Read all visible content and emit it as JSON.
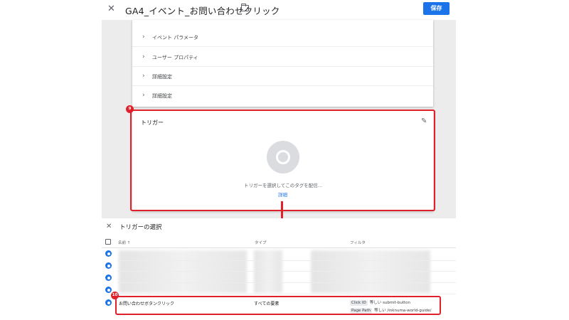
{
  "header": {
    "title": "GA4_イベント_お問い合わせクリック",
    "save_label": "保存"
  },
  "tag_config": {
    "rows": [
      {
        "label": "イベント パラメータ"
      },
      {
        "label": "ユーザー プロパティ"
      },
      {
        "label": "詳細設定"
      },
      {
        "label": "詳細設定"
      }
    ]
  },
  "trigger_section": {
    "badge": "9",
    "title": "トリガー",
    "hint": "トリガーを選択してこのタグを配信...",
    "detail_link": "詳細"
  },
  "trigger_chooser": {
    "title": "トリガーの選択",
    "columns": {
      "name": "名前 ↑",
      "type": "タイプ",
      "filter": "フィルタ"
    },
    "selected_row": {
      "badge": "10",
      "name": "お問い合わせボタンクリック",
      "type": "すべての要素",
      "filters": [
        {
          "key": "Click ID",
          "op": "等しい",
          "value": "submit-button"
        },
        {
          "key": "Page Path",
          "op": "等しい",
          "value": "/inknuma-world-guide/"
        }
      ]
    }
  },
  "colors": {
    "accent": "#1a73e8",
    "annotation": "#e0202a"
  }
}
